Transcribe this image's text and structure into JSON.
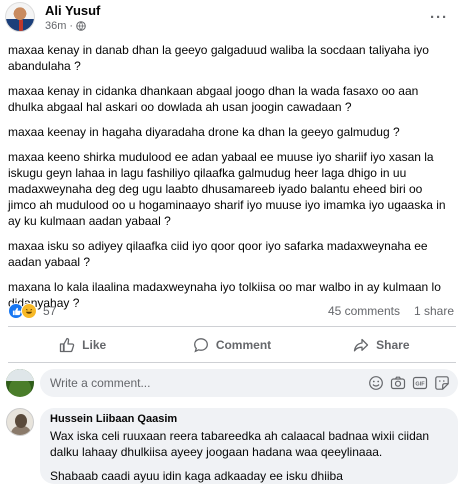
{
  "post": {
    "author": "Ali Yusuf",
    "time": "36m",
    "separator": "·",
    "more_label": "···",
    "paragraphs": [
      "maxaa kenay in danab dhan la geeyo galgaduud waliba la socdaan taliyaha iyo abandulaha ?",
      "maxaa kenay in cidanka dhankaan abgaal joogo dhan la wada fasaxo oo aan dhulka abgaal hal askari oo dowlada ah usan joogin cawadaan ?",
      "maxaa keenay in hagaha diyaradaha drone ka dhan la geeyo galmudug ?",
      "maxaa keeno shirka mudulood ee adan yabaal ee muuse iyo shariif iyo xasan la iskugu geyn lahaa in lagu fashiliyo qilaafka galmudug heer laga dhigo in uu madaxweynaha deg deg ugu laabto dhusamareeb iyado balantu eheed biri oo jimco ah mudulood oo u hogaminaayo sharif iyo muuse iyo imamka iyo ugaaska in ay ku kulmaan aadan yabaal ?",
      "maxaa isku so adiyey qilaafka ciid iyo qoor qoor iyo safarka madaxweynaha ee aadan yabaal ?",
      "maxana lo kala ilaalina madaxweynaha iyo tolkiisa oo mar walbo in ay kulmaan lo didanyahay ?"
    ]
  },
  "stats": {
    "reaction_count": "57",
    "comments": "45 comments",
    "shares": "1 share",
    "reactions": [
      "like",
      "haha"
    ]
  },
  "actions": {
    "like": "Like",
    "comment": "Comment",
    "share": "Share"
  },
  "composer": {
    "placeholder": "Write a comment...",
    "icons": [
      "smiley-icon",
      "camera-icon",
      "gif-icon",
      "sticker-icon"
    ],
    "gif_label": "GIF"
  },
  "reply": {
    "name": "Hussein Liibaan Qaasim",
    "text1": "Wax iska celi ruuxaan reera tabareedka ah calaacal badnaa wixii ciidan dalku lahaay dhulkiisa ayeey joogaan hadana waa qeeylinaaa.",
    "text2": "Shabaab caadi ayuu idin kaga adkaaday ee isku dhiiba"
  },
  "colors": {
    "like_blue": "#1877f2",
    "haha_yellow": "#f7b928",
    "secondary_text": "#65676b",
    "bubble_bg": "#f0f2f5"
  }
}
